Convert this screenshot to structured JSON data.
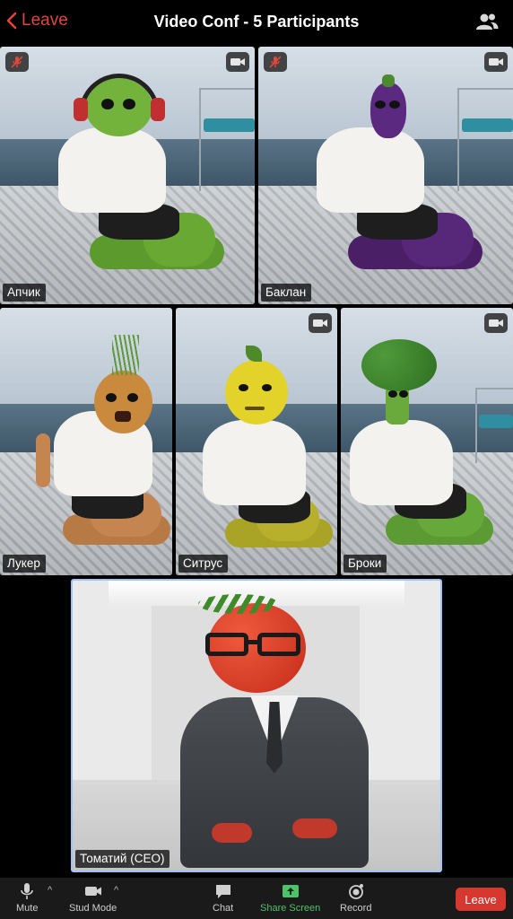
{
  "header": {
    "leave_label": "Leave",
    "title": "Video Conf - 5 Participants",
    "participants_icon": "participants-icon"
  },
  "participants": [
    {
      "name": "Апчик",
      "muted": true,
      "video_icon": true
    },
    {
      "name": "Баклан",
      "muted": true,
      "video_icon": true
    },
    {
      "name": "Лукер",
      "muted": false,
      "video_icon": false
    },
    {
      "name": "Ситрус",
      "muted": false,
      "video_icon": true
    },
    {
      "name": "Броки",
      "muted": false,
      "video_icon": true
    }
  ],
  "featured": {
    "name": "Томатий (CEO)",
    "active_speaker": true
  },
  "toolbar": {
    "mute_label": "Mute",
    "video_label": "Stud Mode",
    "chat_label": "Chat",
    "share_label": "Share Screen",
    "record_label": "Record",
    "leave_label": "Leave"
  },
  "colors": {
    "leave_red": "#d6372e",
    "share_green": "#4fc16a",
    "active_border": "#9ec4f3"
  }
}
